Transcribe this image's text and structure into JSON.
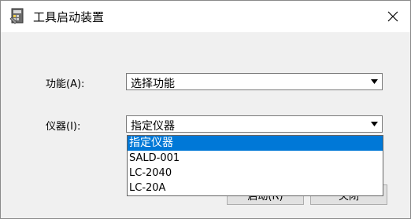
{
  "window": {
    "title": "工具启动装置"
  },
  "fields": {
    "function_label": "功能(A):",
    "function_value": "选择功能",
    "instrument_label": "仪器(I):",
    "instrument_value": "指定仪器"
  },
  "dropdown": {
    "options": [
      "指定仪器",
      "SALD-001",
      "LC-2040",
      "LC-20A"
    ],
    "selected_index": 0
  },
  "buttons": {
    "start_label": "启动(R)",
    "close_label": "关闭"
  },
  "colors": {
    "selection": "#0078d7",
    "window_bg": "#f0f0f0"
  }
}
